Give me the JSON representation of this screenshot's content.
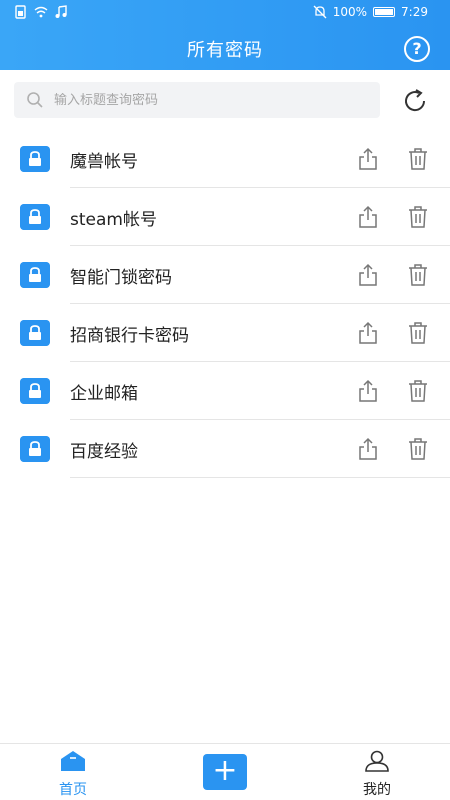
{
  "status_bar": {
    "battery_text": "100%",
    "time": "7:29"
  },
  "header": {
    "title": "所有密码",
    "help_label": "?"
  },
  "search": {
    "placeholder": "输入标题查询密码"
  },
  "entries": [
    {
      "title": "魔兽帐号"
    },
    {
      "title": "steam帐号"
    },
    {
      "title": "智能门锁密码"
    },
    {
      "title": "招商银行卡密码"
    },
    {
      "title": "企业邮箱"
    },
    {
      "title": "百度经验"
    }
  ],
  "tabbar": {
    "home_label": "首页",
    "add_label": "+",
    "me_label": "我的"
  },
  "colors": {
    "accent": "#2a94f1",
    "header_gradient_start": "#3aa6f7"
  }
}
